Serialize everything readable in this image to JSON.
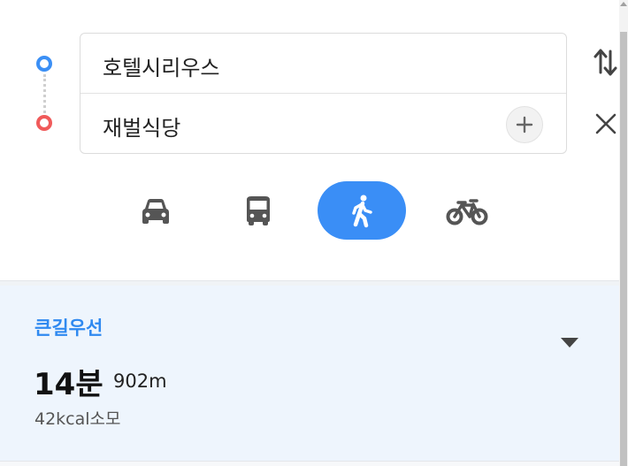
{
  "route_input": {
    "origin": "호텔시리우스",
    "destination": "재벌식당",
    "add_waypoint_icon": "plus-icon",
    "swap_icon": "swap-arrows-icon",
    "close_icon": "close-icon"
  },
  "transport_modes": [
    {
      "icon": "car-icon",
      "selected": false
    },
    {
      "icon": "bus-icon",
      "selected": false
    },
    {
      "icon": "walk-icon",
      "selected": true
    },
    {
      "icon": "bike-icon",
      "selected": false
    }
  ],
  "result": {
    "route_name": "큰길우선",
    "duration": "14분",
    "distance": "902m",
    "calories": "42kcal소모",
    "expand_icon": "chevron-down-icon"
  },
  "colors": {
    "accent": "#3a8ef6",
    "origin_dot": "#3b8ff5",
    "destination_dot": "#f05a5a",
    "result_background": "#eef5fd",
    "icon_gray": "#555555"
  }
}
